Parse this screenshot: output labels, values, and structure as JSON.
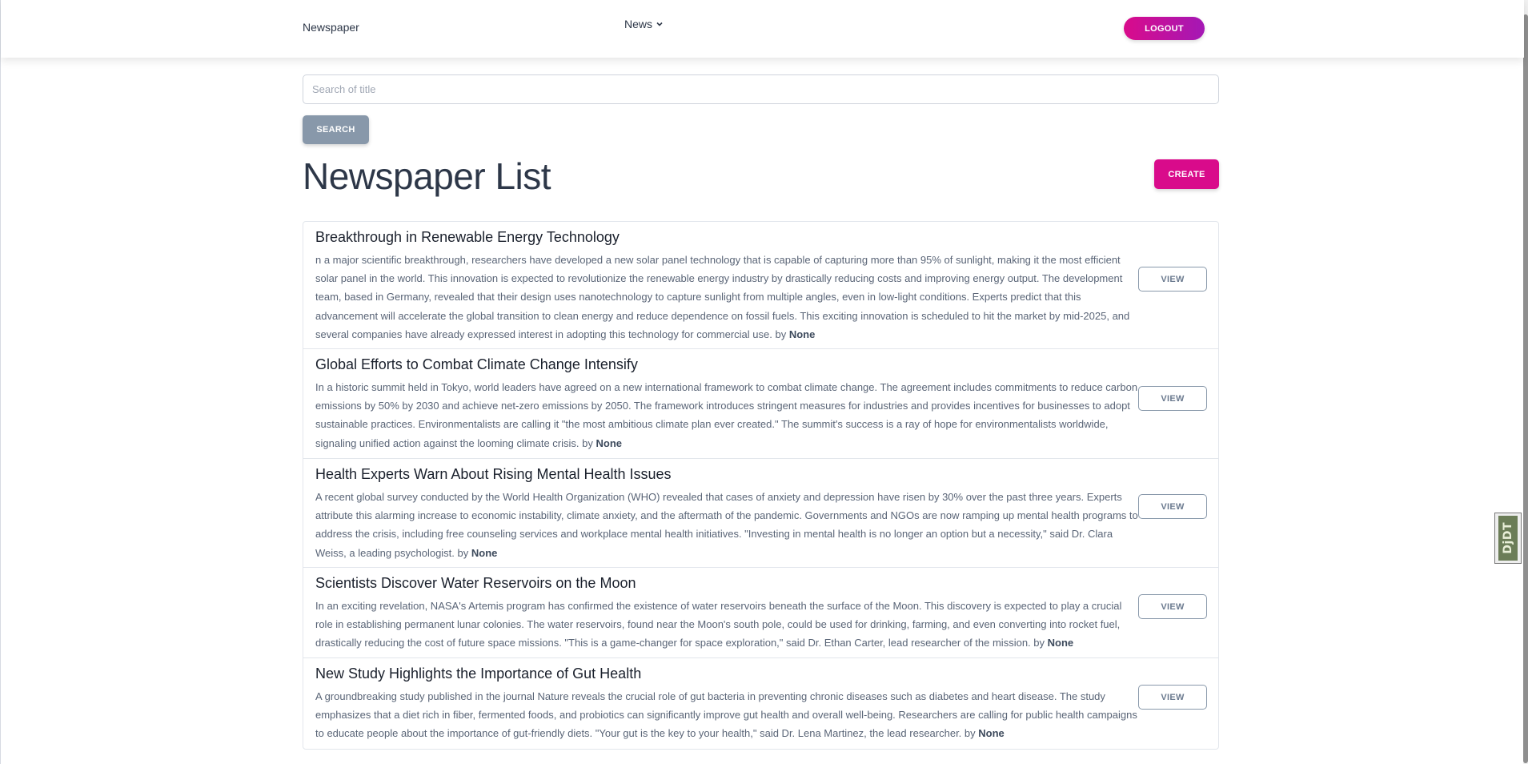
{
  "navbar": {
    "brand": "Newspaper",
    "menu_label": "News",
    "logout_label": "LOGOUT"
  },
  "search": {
    "placeholder": "Search of title",
    "button_label": "SEARCH"
  },
  "page": {
    "title": "Newspaper List",
    "create_label": "CREATE"
  },
  "articles": [
    {
      "title": "Breakthrough in Renewable Energy Technology",
      "body": "n a major scientific breakthrough, researchers have developed a new solar panel technology that is capable of capturing more than 95% of sunlight, making it the most efficient solar panel in the world. This innovation is expected to revolutionize the renewable energy industry by drastically reducing costs and improving energy output. The development team, based in Germany, revealed that their design uses nanotechnology to capture sunlight from multiple angles, even in low-light conditions. Experts predict that this advancement will accelerate the global transition to clean energy and reduce dependence on fossil fuels. This exciting innovation is scheduled to hit the market by mid-2025, and several companies have already expressed interest in adopting this technology for commercial use.",
      "by_label": "by",
      "author": "None",
      "view_label": "VIEW"
    },
    {
      "title": "Global Efforts to Combat Climate Change Intensify",
      "body": "In a historic summit held in Tokyo, world leaders have agreed on a new international framework to combat climate change. The agreement includes commitments to reduce carbon emissions by 50% by 2030 and achieve net-zero emissions by 2050. The framework introduces stringent measures for industries and provides incentives for businesses to adopt sustainable practices. Environmentalists are calling it \"the most ambitious climate plan ever created.\" The summit's success is a ray of hope for environmentalists worldwide, signaling unified action against the looming climate crisis.",
      "by_label": "by",
      "author": "None",
      "view_label": "VIEW"
    },
    {
      "title": "Health Experts Warn About Rising Mental Health Issues",
      "body": "A recent global survey conducted by the World Health Organization (WHO) revealed that cases of anxiety and depression have risen by 30% over the past three years. Experts attribute this alarming increase to economic instability, climate anxiety, and the aftermath of the pandemic. Governments and NGOs are now ramping up mental health programs to address the crisis, including free counseling services and workplace mental health initiatives. \"Investing in mental health is no longer an option but a necessity,\" said Dr. Clara Weiss, a leading psychologist.",
      "by_label": "by",
      "author": "None",
      "view_label": "VIEW"
    },
    {
      "title": "Scientists Discover Water Reservoirs on the Moon",
      "body": "In an exciting revelation, NASA's Artemis program has confirmed the existence of water reservoirs beneath the surface of the Moon. This discovery is expected to play a crucial role in establishing permanent lunar colonies. The water reservoirs, found near the Moon's south pole, could be used for drinking, farming, and even converting into rocket fuel, drastically reducing the cost of future space missions. \"This is a game-changer for space exploration,\" said Dr. Ethan Carter, lead researcher of the mission.",
      "by_label": "by",
      "author": "None",
      "view_label": "VIEW"
    },
    {
      "title": "New Study Highlights the Importance of Gut Health",
      "body": "A groundbreaking study published in the journal Nature reveals the crucial role of gut bacteria in preventing chronic diseases such as diabetes and heart disease. The study emphasizes that a diet rich in fiber, fermented foods, and probiotics can significantly improve gut health and overall well-being. Researchers are calling for public health campaigns to educate people about the importance of gut-friendly diets. \"Your gut is the key to your health,\" said Dr. Lena Martinez, the lead researcher.",
      "by_label": "by",
      "author": "None",
      "view_label": "VIEW"
    }
  ],
  "debug_toolbar": {
    "label": "DjDT"
  },
  "colors": {
    "accent": "#d90b8b",
    "accent_gradient_end": "#a418b5",
    "secondary": "#8898aa",
    "text": "#2d3748"
  }
}
